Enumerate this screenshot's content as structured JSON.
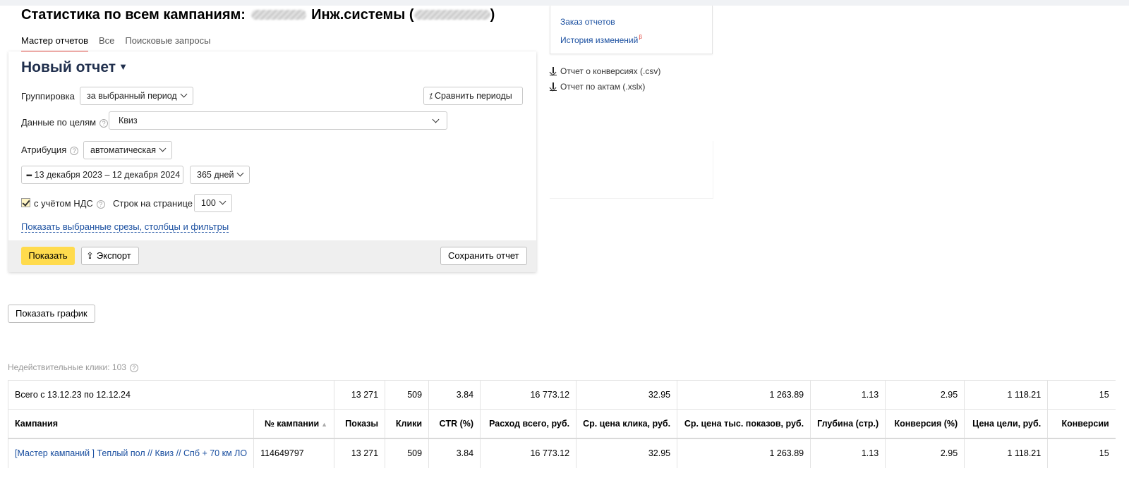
{
  "header": {
    "title_prefix": "Статистика по всем кампаниям:",
    "title_client": "Инж.системы (",
    "title_suffix": ")"
  },
  "tabs": [
    {
      "label": "Мастер отчетов",
      "active": true
    },
    {
      "label": "Все",
      "active": false
    },
    {
      "label": "Поисковые запросы",
      "active": false
    }
  ],
  "report": {
    "title": "Новый отчет",
    "title_caret": "▼",
    "grouping_label": "Группировка",
    "grouping_value": "за выбранный период",
    "compare_button": "Сравнить периоды",
    "goals_label": "Данные по целям",
    "goals_value": "Квиз",
    "attribution_label": "Атрибуция",
    "attribution_value": "автоматическая",
    "date_range": "13 декабря 2023 – 12 декабря 2024",
    "period_value": "365 дней",
    "vat_label": "с учётом НДС",
    "vat_checked": true,
    "rows_label": "Строк на странице",
    "rows_value": "100",
    "show_slices_link": "Показать выбранные срезы, столбцы и фильтры",
    "show_button": "Показать",
    "export_button": "Экспорт",
    "save_button": "Сохранить отчет"
  },
  "sidebar": {
    "order_reports": "Заказ отчетов",
    "change_history": "История изменений",
    "beta_mark": "β",
    "conversions_report": "Отчет о конверсиях (.csv)",
    "acts_report": "Отчет по актам (.xslx)"
  },
  "show_chart_button": "Показать график",
  "invalid_clicks": "Недействительные клики: 103",
  "table": {
    "total_row": {
      "label": "Всего с 13.12.23 по 12.12.24",
      "cells": [
        "13 271",
        "509",
        "3.84",
        "16 773.12",
        "32.95",
        "1 263.89",
        "1.13",
        "2.95",
        "1 118.21",
        "15"
      ]
    },
    "headers": [
      "Кампания",
      "№ кампании",
      "Показы",
      "Клики",
      "CTR (%)",
      "Расход всего, руб.",
      "Ср. цена клика, руб.",
      "Ср. цена тыс. показов, руб.",
      "Глубина (стр.)",
      "Конверсия (%)",
      "Цена цели, руб.",
      "Конверсии"
    ],
    "sort_indicator": "▲",
    "rows": [
      {
        "campaign": "[Мастер кампаний ] Теплый пол // Квиз // Спб + 70 км ЛО",
        "campaign_id": "114649797",
        "cells": [
          "13 271",
          "509",
          "3.84",
          "16 773.12",
          "32.95",
          "1 263.89",
          "1.13",
          "2.95",
          "1 118.21",
          "15"
        ]
      }
    ]
  }
}
